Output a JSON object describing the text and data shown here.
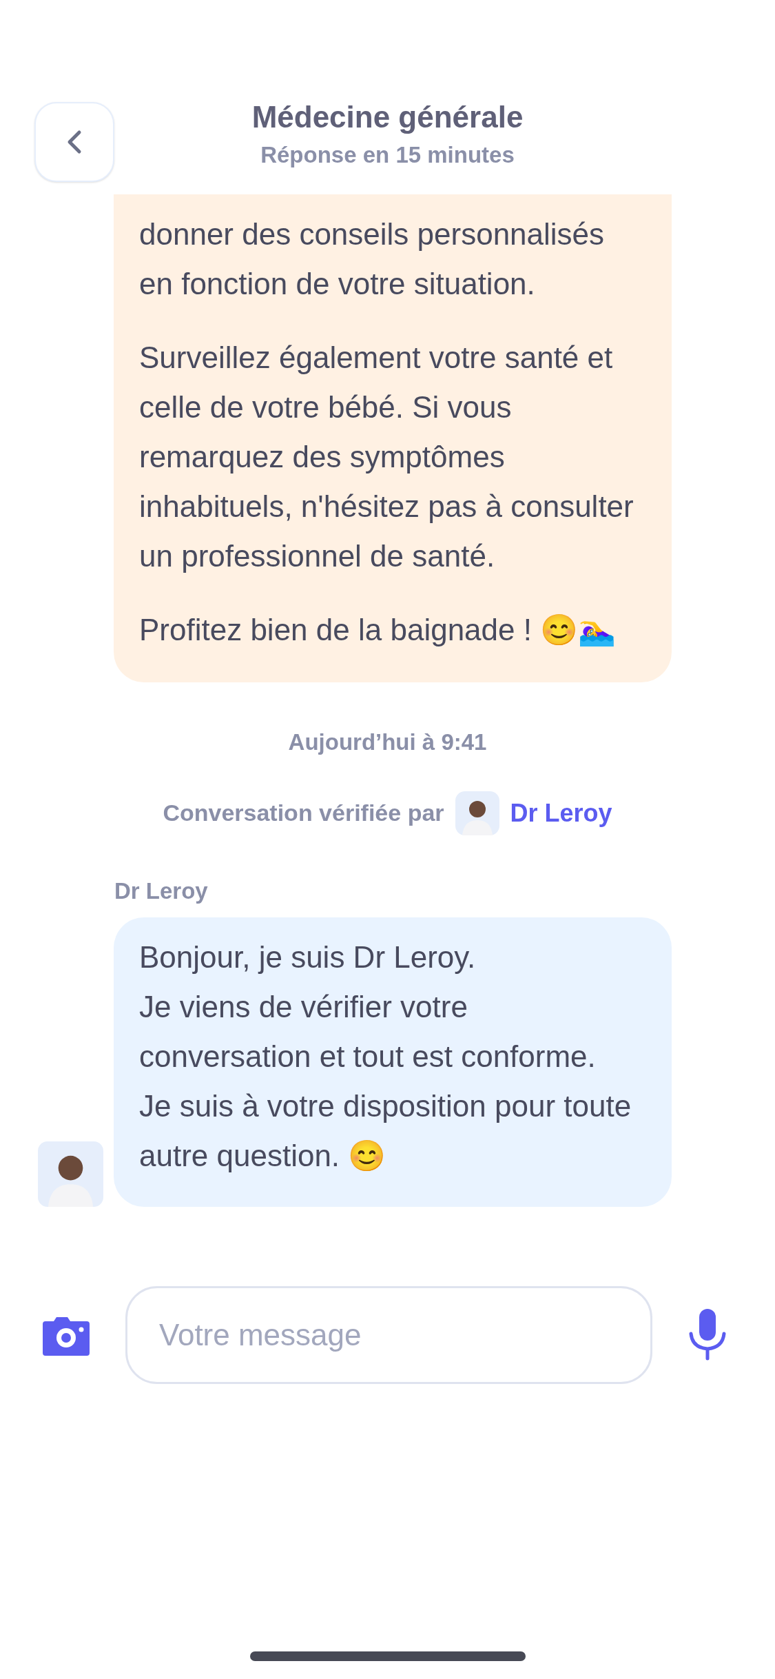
{
  "header": {
    "title": "Médecine générale",
    "subtitle": "Réponse en 15 minutes"
  },
  "bot_message": {
    "paragraphs": [
      "donner des conseils personnalisés en fonction de votre situation.",
      "Surveillez également votre santé et celle de votre bébé. Si vous remarquez des symptômes inhabituels, n'hésitez pas à consulter un professionnel de santé.",
      "Profitez bien de la baignade ! 😊🏊‍♀️"
    ]
  },
  "timestamp": "Aujourd’hui à 9:41",
  "verification": {
    "text": "Conversation vérifiée par",
    "doctor": "Dr Leroy"
  },
  "doctor_message": {
    "sender": "Dr Leroy",
    "text": "Bonjour, je suis Dr Leroy.\nJe viens de vérifier votre conversation et tout est conforme. Je suis à votre disposition pour toute autre question. 😊"
  },
  "composer": {
    "placeholder": "Votre message"
  }
}
